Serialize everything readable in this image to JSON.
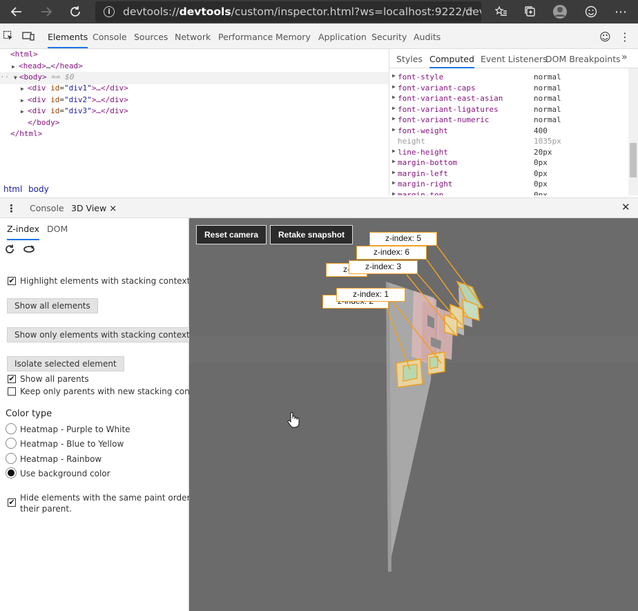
{
  "browser": {
    "url_prefix": "devtools://",
    "url_bold": "devtools",
    "url_rest": "/custom/inspector.html?ws=localhost:9222/devt...",
    "back_icon": "arrow-left-icon",
    "forward_icon": "arrow-right-icon",
    "refresh_icon": "refresh-icon",
    "menu_icon": "ellipsis-icon"
  },
  "devtools": {
    "tabs": [
      "Elements",
      "Console",
      "Sources",
      "Network",
      "Performance",
      "Memory",
      "Application",
      "Security",
      "Audits"
    ],
    "active_tab": "Elements"
  },
  "dom_tree": {
    "html_open": "<html>",
    "head_open": "<head>",
    "head_ellipsis": "…",
    "head_close": "</head>",
    "body_open": "<body>",
    "body_ref": "== $0",
    "divs": [
      {
        "open_tag": "<div ",
        "attr": "id",
        "value": "\"div1\"",
        "rest": ">…</div>"
      },
      {
        "open_tag": "<div ",
        "attr": "id",
        "value": "\"div2\"",
        "rest": ">…</div>"
      },
      {
        "open_tag": "<div ",
        "attr": "id",
        "value": "\"div3\"",
        "rest": ">…</div>"
      }
    ],
    "body_close": "</body>",
    "html_close": "</html>",
    "dots": "··"
  },
  "styles_pane": {
    "tabs": [
      "Styles",
      "Computed",
      "Event Listeners",
      "DOM Breakpoints"
    ],
    "active_tab": "Computed",
    "more_icon": "chevrons-right-icon",
    "properties": [
      {
        "name": "font-style",
        "value": "normal",
        "inherited": false
      },
      {
        "name": "font-variant-caps",
        "value": "normal",
        "inherited": false
      },
      {
        "name": "font-variant-east-asian",
        "value": "normal",
        "inherited": false
      },
      {
        "name": "font-variant-ligatures",
        "value": "normal",
        "inherited": false
      },
      {
        "name": "font-variant-numeric",
        "value": "normal",
        "inherited": false
      },
      {
        "name": "font-weight",
        "value": "400",
        "inherited": false
      },
      {
        "name": "height",
        "value": "1035px",
        "inherited": true
      },
      {
        "name": "line-height",
        "value": "20px",
        "inherited": false
      },
      {
        "name": "margin-bottom",
        "value": "0px",
        "inherited": false
      },
      {
        "name": "margin-left",
        "value": "0px",
        "inherited": false
      },
      {
        "name": "margin-right",
        "value": "0px",
        "inherited": false
      },
      {
        "name": "margin-top",
        "value": "0px",
        "inherited": false
      }
    ]
  },
  "breadcrumb": [
    "html",
    "body"
  ],
  "drawer": {
    "tabs": [
      "Console",
      "3D View"
    ],
    "active_tab": "3D View",
    "close_label": "×",
    "drawer_close": "✕"
  },
  "view3d": {
    "subtabs": [
      "Z-index",
      "DOM"
    ],
    "active_subtab": "Z-index",
    "highlight_label": "Highlight elements with stacking context",
    "highlight_checked": true,
    "show_all_label": "Show all elements",
    "show_stacking_label": "Show only elements with stacking context",
    "isolate_label": "Isolate selected element",
    "show_parents_label": "Show all parents",
    "show_parents_checked": true,
    "keep_parents_label": "Keep only parents with new stacking context",
    "keep_parents_checked": false,
    "color_type_title": "Color type",
    "color_options": [
      "Heatmap - Purple to White",
      "Heatmap - Blue to Yellow",
      "Heatmap - Rainbow",
      "Use background color"
    ],
    "selected_color": "Use background color",
    "hide_same_label_1": "Hide elements with the same paint order as",
    "hide_same_label_2": "their parent.",
    "hide_same_checked": true,
    "reset_camera_label": "Reset camera",
    "retake_snapshot_label": "Retake snapshot",
    "zlabels": [
      "z-index: 5",
      "z-index: 6",
      "z-",
      "z-index: 3",
      "z-index: 1",
      "z-index: 2"
    ]
  },
  "colors": {
    "accent": "#1a73e8",
    "viewport_bg": "#6b6b6b",
    "label_border": "#f0a020",
    "tag": "#881280"
  }
}
